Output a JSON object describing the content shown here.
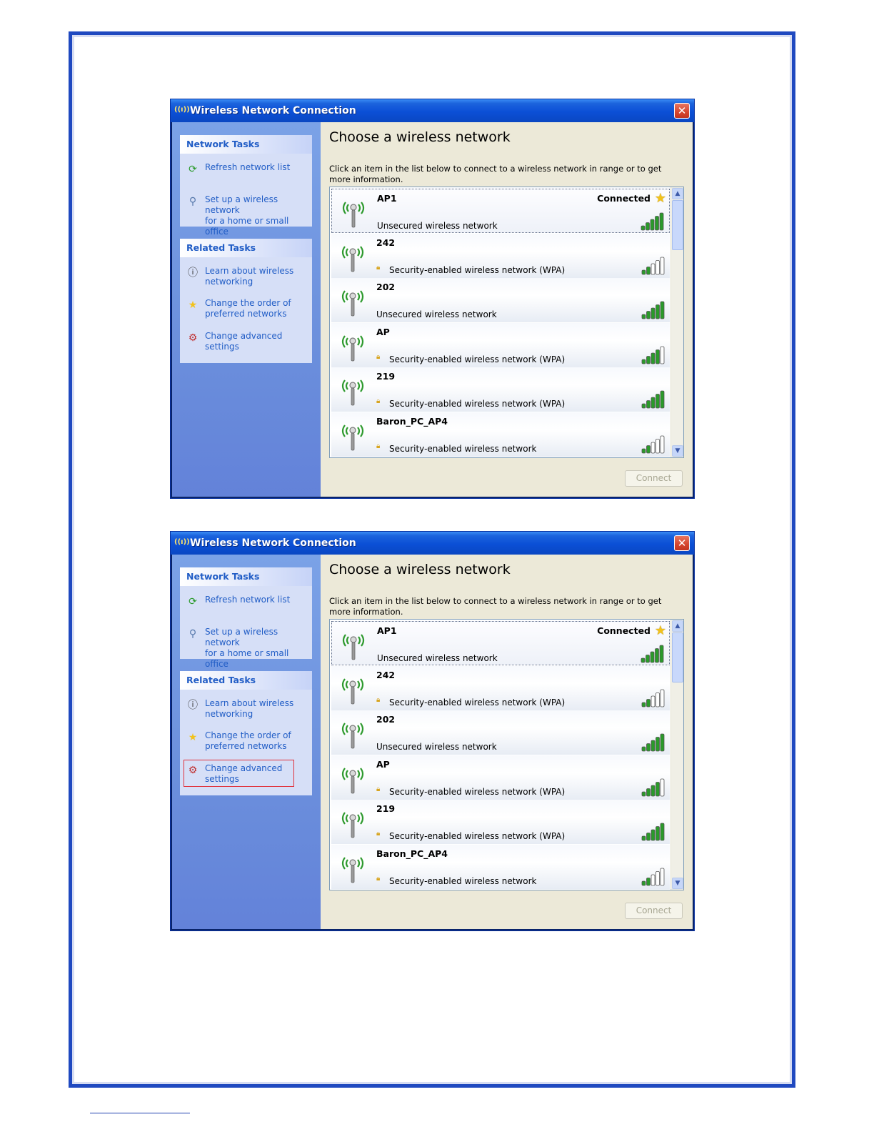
{
  "window": {
    "title": "Wireless Network Connection",
    "close_glyph": "✕"
  },
  "network_tasks": {
    "header": "Network Tasks",
    "items": [
      {
        "label": "Refresh network list",
        "icon": "refresh-icon"
      },
      {
        "label": "Set up a wireless network\nfor a home or small office",
        "icon": "setup-wireless-icon"
      }
    ]
  },
  "related_tasks": {
    "header": "Related Tasks",
    "items": [
      {
        "label": "Learn about wireless\nnetworking",
        "icon": "info-icon"
      },
      {
        "label": "Change the order of\npreferred networks",
        "icon": "star-icon"
      },
      {
        "label": "Change advanced\nsettings",
        "icon": "settings-icon"
      }
    ]
  },
  "main": {
    "heading": "Choose a wireless network",
    "description": "Click an item in the list below to connect to a wireless network in range or to get more information."
  },
  "networks": [
    {
      "name": "AP1",
      "status": "Connected",
      "security": "Unsecured wireless network",
      "secured": false,
      "signal_bars": 5,
      "selected": true
    },
    {
      "name": "242",
      "status": "",
      "security": "Security-enabled wireless network (WPA)",
      "secured": true,
      "signal_bars": 2,
      "selected": false
    },
    {
      "name": "202",
      "status": "",
      "security": "Unsecured wireless network",
      "secured": false,
      "signal_bars": 5,
      "selected": false
    },
    {
      "name": "AP",
      "status": "",
      "security": "Security-enabled wireless network (WPA)",
      "secured": true,
      "signal_bars": 4,
      "selected": false
    },
    {
      "name": "219",
      "status": "",
      "security": "Security-enabled wireless network (WPA)",
      "secured": true,
      "signal_bars": 5,
      "selected": false
    },
    {
      "name": "Baron_PC_AP4",
      "status": "",
      "security": "Security-enabled wireless network",
      "secured": true,
      "signal_bars": 2,
      "selected": false
    }
  ],
  "connect_label": "Connect",
  "colors": {
    "signal_on": "#2a9a2a",
    "signal_off": "#ffffff",
    "highlight_box": "#e0303a",
    "link_blue": "#215dc6"
  }
}
